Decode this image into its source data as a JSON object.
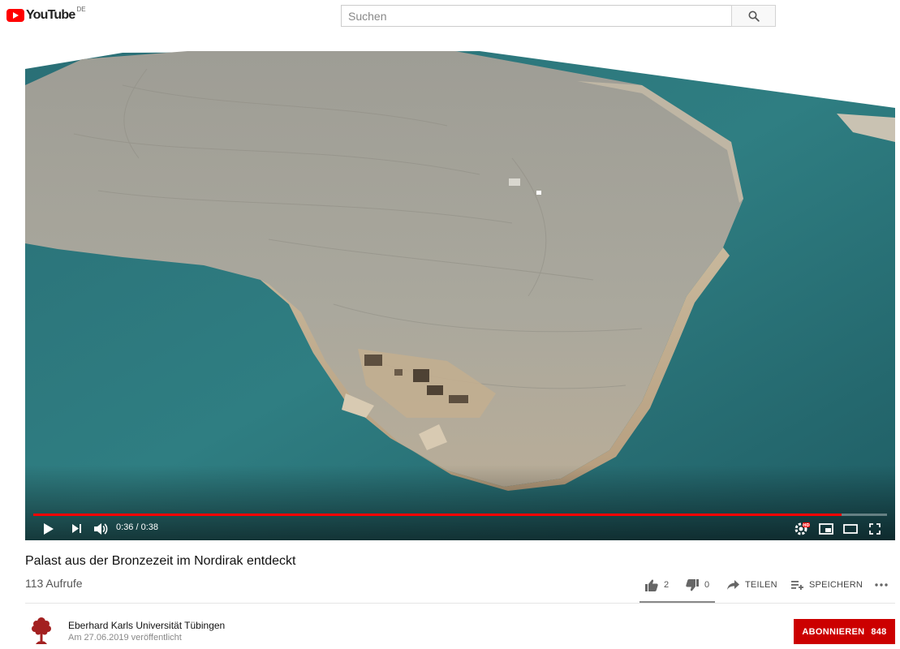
{
  "header": {
    "logo_text": "YouTube",
    "logo_country": "DE",
    "search_placeholder": "Suchen"
  },
  "player": {
    "time_display": "0:36 / 0:38",
    "progress_fraction": 0.947,
    "buffered_fraction": 0.947,
    "colors": {
      "progress": "#ff0000",
      "water": "#2f7e82",
      "land": "#a9a79c"
    },
    "icons": [
      "play-icon",
      "next-icon",
      "volume-icon",
      "settings-hd-icon",
      "miniplayer-icon",
      "theater-mode-icon",
      "fullscreen-icon"
    ]
  },
  "video": {
    "title": "Palast aus der Bronzezeit im Nordirak entdeckt",
    "views": "113 Aufrufe"
  },
  "actions": {
    "like_count": "2",
    "dislike_count": "0",
    "share_label": "TEILEN",
    "save_label": "SPEICHERN"
  },
  "channel": {
    "name": "Eberhard Karls Universität Tübingen",
    "published": "Am 27.06.2019 veröffentlicht",
    "subscribe_label": "ABONNIEREN",
    "subscriber_count": "848",
    "accent_color": "#cc0000"
  }
}
